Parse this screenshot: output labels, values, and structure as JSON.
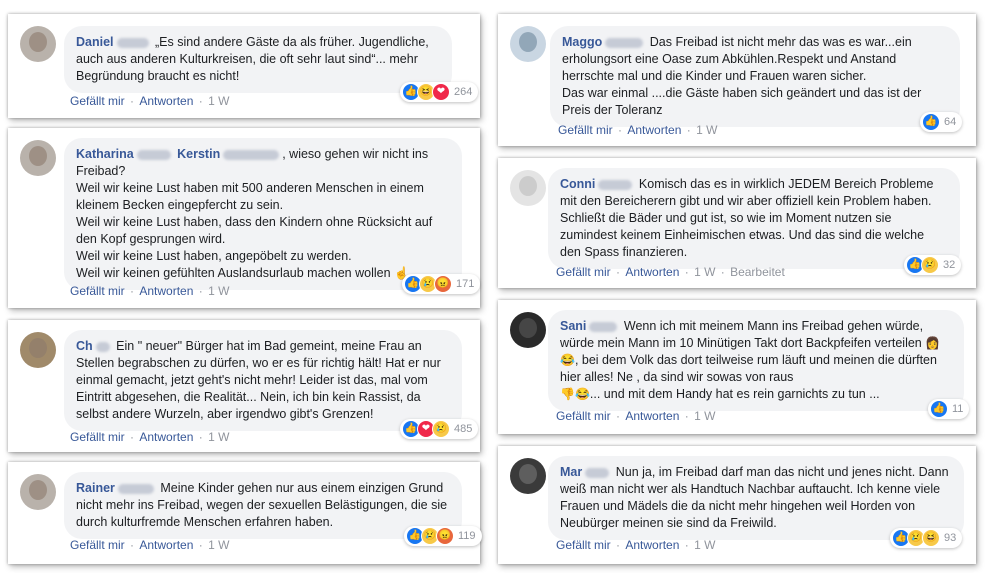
{
  "action_labels": {
    "like": "Gefällt mir",
    "reply": "Antworten",
    "time": "1 W"
  },
  "comments": {
    "c1": {
      "author": "Daniel",
      "text": "„Es sind andere Gäste da als früher. Jugendliche, auch aus anderen Kulturkreisen, die oft sehr laut sind“... mehr Begründung braucht es nicht!",
      "count": "264"
    },
    "c2": {
      "author": "Katharina",
      "author2": "Kerstin",
      "text_a": ", wieso gehen wir nicht ins Freibad?",
      "text_b": "Weil wir keine Lust haben mit 500 anderen Menschen in einem kleinem Becken eingepfercht zu sein.",
      "text_c": "Weil wir keine Lust haben, dass den Kindern ohne Rücksicht auf den Kopf gesprungen wird.",
      "text_d": "Weil wir keine Lust haben, angepöbelt zu werden.",
      "text_e": "Weil wir keinen gefühlten Auslandsurlaub machen wollen",
      "count": "171"
    },
    "c3": {
      "author": "Ch",
      "text": "Ein \" neuer\" Bürger hat im Bad gemeint, meine Frau an Stellen begrabschen zu dürfen, wo er es für richtig hält! Hat er nur einmal gemacht, jetzt geht's nicht mehr! Leider ist das, mal vom Eintritt abgesehen, die Realität... Nein, ich bin kein Rassist, da selbst andere Wurzeln, aber irgendwo gibt's Grenzen!",
      "count": "485"
    },
    "c4": {
      "author": "Rainer",
      "text": "Meine Kinder gehen nur aus einem einzigen Grund nicht mehr ins Freibad, wegen der sexuellen Belästigungen, die sie durch kulturfremde Menschen erfahren haben.",
      "count": "119"
    },
    "c5": {
      "author": "Maggo",
      "text_a": "Das Freibad ist nicht mehr das was es war...ein erholungsort eine Oase zum Abkühlen.Respekt und Anstand herrschte mal und die Kinder und Frauen waren sicher.",
      "text_b": "Das war einmal ....die Gäste haben sich geändert und das ist der Preis der Toleranz",
      "count": "64"
    },
    "c6": {
      "author": "Conni",
      "text": "Komisch das es in wirklich JEDEM Bereich Probleme mit den Bereicherern gibt und wir aber offiziell kein Problem haben. Schließt die Bäder und gut ist, so wie im Moment nutzen sie zumindest keinem Einheimischen etwas. Und das sind die welche den Spass finanzieren.",
      "edited": "Bearbeitet",
      "count": "32"
    },
    "c7": {
      "author": "Sani",
      "text_a": "Wenn ich mit meinem Mann ins Freibad gehen würde, würde mein Mann im 10 Minütigen Takt dort Backpfeifen verteilen",
      "text_b": ", bei dem Volk das dort teilweise rum läuft und meinen die dürften hier alles! Ne , da sind wir sowas von raus",
      "text_c": "... und mit dem Handy hat es rein garnichts zu tun ...",
      "count": "11"
    },
    "c8": {
      "author": "Mar",
      "text": "Nun ja, im Freibad darf man das nicht und jenes nicht. Dann weiß man nicht wer als Handtuch Nachbar auftaucht. Ich kenne viele Frauen und Mädels die da nicht mehr hingehen weil Horden von Neubürger meinen sie sind da Freiwild.",
      "count": "93"
    }
  },
  "icons": {
    "like": "thumbs-up-icon",
    "sad": "sad-face-icon",
    "angry": "angry-face-icon",
    "love": "heart-icon",
    "haha": "laughing-face-icon"
  },
  "colors": {
    "author": "#385898",
    "bubble": "#f2f3f5",
    "like": "#1877f2"
  }
}
